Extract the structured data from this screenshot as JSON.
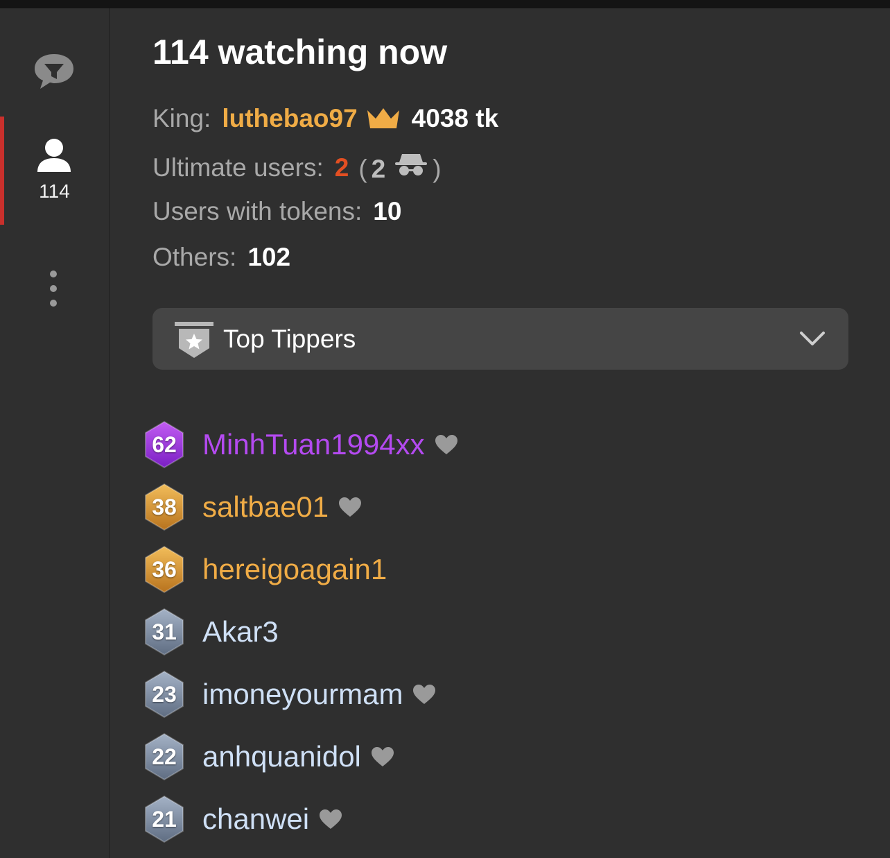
{
  "sidebar": {
    "users_count": "114"
  },
  "header": {
    "title": "114 watching now"
  },
  "stats": {
    "king_label": "King:",
    "king_name": "luthebao97",
    "king_tokens": "4038 tk",
    "ultimate_label": "Ultimate users:",
    "ultimate_value": "2",
    "ultimate_open": "(",
    "ultimate_hidden": "2",
    "ultimate_close": ")",
    "tokens_label": "Users with tokens:",
    "tokens_value": "10",
    "others_label": "Others:",
    "others_value": "102"
  },
  "dropdown": {
    "label": "Top Tippers"
  },
  "tippers": [
    {
      "level": "62",
      "name": "MinhTuan1994xx",
      "tier": "purple",
      "heart": true
    },
    {
      "level": "38",
      "name": "saltbae01",
      "tier": "gold",
      "heart": true
    },
    {
      "level": "36",
      "name": "hereigoagain1",
      "tier": "gold",
      "heart": false
    },
    {
      "level": "31",
      "name": "Akar3",
      "tier": "silver",
      "heart": false
    },
    {
      "level": "23",
      "name": "imoneyourmam",
      "tier": "silver",
      "heart": true
    },
    {
      "level": "22",
      "name": "anhquanidol",
      "tier": "silver",
      "heart": true
    },
    {
      "level": "21",
      "name": "chanwei",
      "tier": "silver",
      "heart": true
    }
  ],
  "colors": {
    "accent_red": "#c9302c",
    "king_gold": "#f0ac46",
    "ultimate_orange": "#e24f22",
    "purple": "#b44af0",
    "silver": "#cfe0f6",
    "background": "#2f2f2f"
  },
  "icons": {
    "sidebar_chat": "chat-filter-icon",
    "sidebar_users": "user-icon",
    "sidebar_more": "more-vertical-icon",
    "king": "crown-icon",
    "hidden_users": "incognito-icon",
    "dropdown": "star-badge-icon",
    "dropdown_toggle": "chevron-down-icon",
    "favorite": "heart-icon"
  }
}
